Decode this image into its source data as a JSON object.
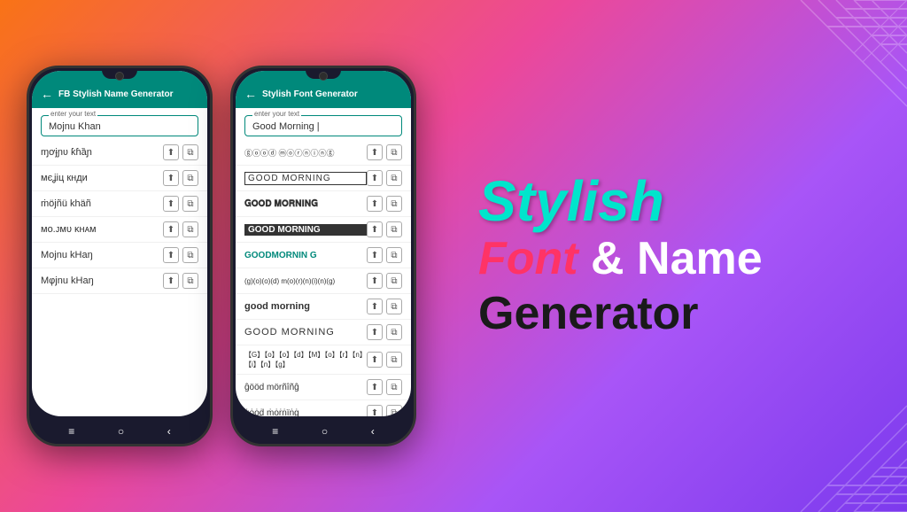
{
  "phones": [
    {
      "id": "phone1",
      "appbar": {
        "title": "FB Stylish Name Generator",
        "back_arrow": "←"
      },
      "input": {
        "label": "enter your text",
        "value": "Mojnu Khan"
      },
      "items": [
        {
          "text": "ɱơɉɲʋ ƙɦȁɲ",
          "style": "fancy"
        },
        {
          "text": "мєʝiц кнди",
          "style": "fancy"
        },
        {
          "text": "ṁöjñü khäñ",
          "style": "fancy"
        },
        {
          "text": "ᴍᴏ.ᴊᴍᴜ ᴋʜᴀᴍ",
          "style": "fancy"
        },
        {
          "text": "Mojnu kHaŋ",
          "style": "normal"
        },
        {
          "text": "Mφjnu kHaŋ",
          "style": "normal"
        }
      ],
      "nav": [
        "≡",
        "○",
        "‹"
      ]
    },
    {
      "id": "phone2",
      "appbar": {
        "title": "Stylish Font Generator",
        "back_arrow": "←"
      },
      "input": {
        "label": "enter your text",
        "value": "Good Morning |"
      },
      "items": [
        {
          "text": "ⓖⓞⓞⓓ ⓜⓞⓡⓝⓘⓝⓖ",
          "style": "circled"
        },
        {
          "text": "GOOD MORNING",
          "style": "boxed"
        },
        {
          "text": "𝐆𝐎𝐎𝐃 𝐌𝐎𝐑𝐍𝐈𝐍𝐆",
          "style": "bold-circle"
        },
        {
          "text": "GOOD MORNING",
          "style": "dark-bg"
        },
        {
          "text": "GOODMORNIN G",
          "style": "teal"
        },
        {
          "text": "(g)(o)(o)(d) m(o)(r)(n)(i)(n)(g)",
          "style": "bracket"
        },
        {
          "text": "good morning",
          "style": "bold"
        },
        {
          "text": "GOOD MORNING",
          "style": "uppercase"
        },
        {
          "text": "【G】【o】【o】【d】【M】【o】【r】【n】【i】【n】【g】",
          "style": "outline"
        },
        {
          "text": "ĝööd mörñîñĝ",
          "style": "fancy"
        },
        {
          "text": "ġȯȯḋ ṁȯṙṅïṅġ",
          "style": "fancy2"
        }
      ],
      "nav": [
        "≡",
        "○",
        "‹"
      ]
    }
  ],
  "branding": {
    "line1": "Stylish",
    "line2_font": "Font",
    "line2_and": " & Name",
    "line3": "Generator"
  },
  "actions": {
    "share_icon": "⬆",
    "copy_icon": "⧉"
  }
}
